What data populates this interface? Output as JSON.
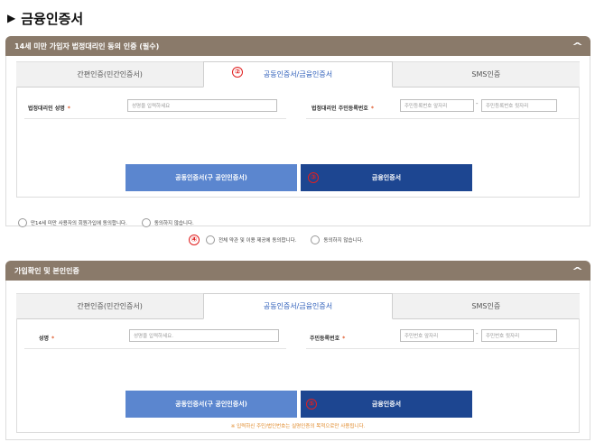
{
  "page": {
    "title": "금융인증서"
  },
  "section1": {
    "header": "14세 미만 가입자 법정대리인 동의 인증 (필수)",
    "tabs": [
      "간편인증(민간인증서)",
      "공동인증서/금융인증서",
      "SMS인증"
    ],
    "active_tab": 1,
    "name_label": "법정대리인 성명",
    "name_placeholder": "성명을 입력하세요",
    "rrn_label": "법정대리인 주민등록번호",
    "rrn_front_placeholder": "주민등록번호 앞자리",
    "rrn_back_placeholder": "주민등록번호 뒷자리",
    "btn_joint": "공동인증서(구 공인인증서)",
    "btn_financial": "금융인증서",
    "agree_label": "만14세 미만 사용자의 회원가입에 동의합니다.",
    "disagree_label": "동의하지 않습니다."
  },
  "middle": {
    "agree_label": "전체 약관 및 이용 제공에 동의합니다.",
    "disagree_label": "동의하지 않습니다."
  },
  "section2": {
    "header": "가입확인 및 본인인증",
    "tabs": [
      "간편인증(민간인증서)",
      "공동인증서/금융인증서",
      "SMS인증"
    ],
    "active_tab": 1,
    "name_label": "성명",
    "name_placeholder": "성명을 입력하세요.",
    "rrn_label": "주민등록번호",
    "rrn_front_placeholder": "주민번호 앞자리",
    "rrn_back_placeholder": "주민번호 뒷자리",
    "btn_joint": "공동인증서(구 공인인증서)",
    "btn_financial": "금융인증서",
    "notice": "※ 입력하신 주민/법인번호는 실명인증의 목적으로만 사용됩니다."
  },
  "markers": {
    "m2": "②",
    "m3": "③",
    "m4": "④",
    "m5": "⑤"
  },
  "colors": {
    "header_bg": "#8a7a6a",
    "btn_light": "#5b86cf",
    "btn_dark": "#1d4691",
    "accent": "#2a5bb8"
  }
}
